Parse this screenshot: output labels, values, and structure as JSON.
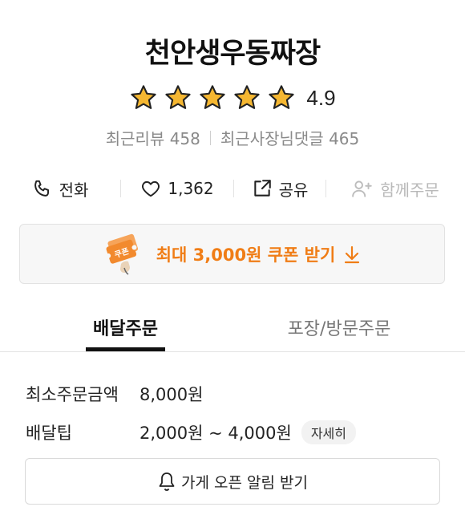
{
  "store": {
    "name": "천안생우동짜장",
    "rating": "4.9",
    "star_count": 5,
    "star_color": "#F5B731",
    "recent_reviews_label": "최근리뷰",
    "recent_reviews_count": "458",
    "owner_replies_label": "최근사장님댓글",
    "owner_replies_count": "465"
  },
  "actions": {
    "call": {
      "label": "전화",
      "icon": "phone-icon"
    },
    "like": {
      "label": "1,362",
      "icon": "heart-icon"
    },
    "share": {
      "label": "공유",
      "icon": "share-icon"
    },
    "group_order": {
      "label": "함께주문",
      "icon": "add-person-icon",
      "disabled": true
    }
  },
  "coupon": {
    "label": "최대 3,000원 쿠폰 받기",
    "badge_text": "쿠폰",
    "accent_color": "#F07D16"
  },
  "tabs": {
    "delivery": "배달주문",
    "pickup": "포장/방문주문",
    "active": "delivery"
  },
  "delivery_info": {
    "min_order_label": "최소주문금액",
    "min_order_value": "8,000원",
    "tip_label": "배달팁",
    "tip_value": "2,000원 ~ 4,000원",
    "tip_detail": "자세히"
  },
  "notify": {
    "label": "가게 오픈 알림 받기",
    "icon": "bell-icon"
  }
}
